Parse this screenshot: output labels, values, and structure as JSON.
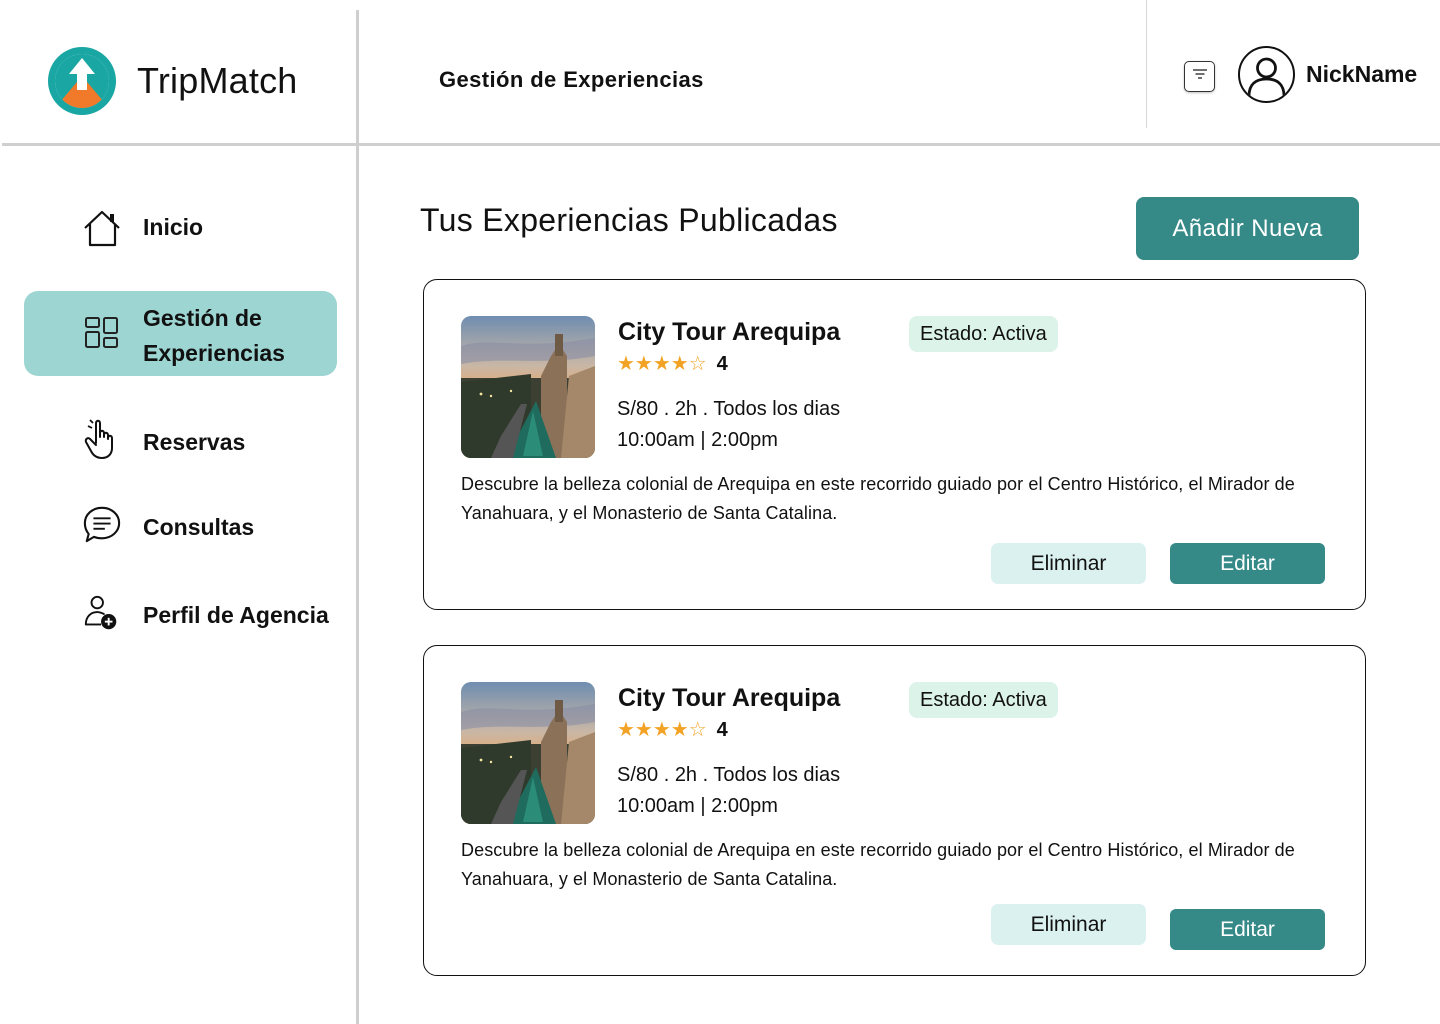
{
  "header": {
    "brand": "TripMatch",
    "page_heading": "Gestión de Experiencias",
    "username": "NickName",
    "filter_icon": "filter-icon",
    "avatar_icon": "user-avatar-icon"
  },
  "sidebar": {
    "items": [
      {
        "label": "Inicio",
        "icon": "home-icon",
        "active": false
      },
      {
        "label": "Gestión de Experiencias",
        "label_line1": "Gestión de",
        "label_line2": "Experiencias",
        "icon": "grid-icon",
        "active": true
      },
      {
        "label": "Reservas",
        "icon": "hand-pointer-icon",
        "active": false
      },
      {
        "label": "Consultas",
        "icon": "chat-icon",
        "active": false
      },
      {
        "label": "Perfil de Agencia",
        "icon": "user-add-icon",
        "active": false
      }
    ]
  },
  "main": {
    "title": "Tus Experiencias Publicadas",
    "add_button": "Añadir Nueva",
    "experiences": [
      {
        "title": "City Tour Arequipa",
        "status": "Estado: Activa",
        "stars": "★★★★☆",
        "rating": "4",
        "price_line": "S/80 . 2h . Todos los dias",
        "schedule": "10:00am | 2:00pm",
        "description": "Descubre la belleza colonial de Arequipa en este recorrido guiado por el Centro Histórico, el Mirador de Yanahuara, y el Monasterio de Santa Catalina.",
        "delete_label": "Eliminar",
        "edit_label": "Editar"
      },
      {
        "title": "City Tour Arequipa",
        "status": "Estado: Activa",
        "stars": "★★★★☆",
        "rating": "4",
        "price_line": "S/80 . 2h . Todos los dias",
        "schedule": "10:00am | 2:00pm",
        "description": "Descubre la belleza colonial de Arequipa en este recorrido guiado por el Centro Histórico, el Mirador de Yanahuara, y el Monasterio de Santa Catalina.",
        "delete_label": "Eliminar",
        "edit_label": "Editar"
      }
    ]
  },
  "colors": {
    "accent": "#358a88",
    "active_nav": "#9dd5d3",
    "status_bg": "#dcf3ea",
    "delete_bg": "#daf1ef",
    "star": "#f2a325"
  }
}
